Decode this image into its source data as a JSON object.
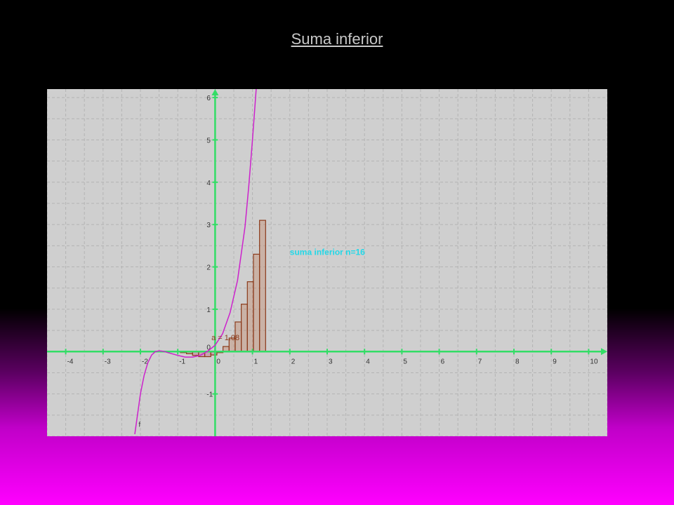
{
  "slide": {
    "title": "Suma inferior"
  },
  "chart_data": {
    "type": "bar",
    "title": "Suma inferior",
    "function_label": "f",
    "parameter_label": "a = 1.08",
    "sum_label": "suma inferior n=16",
    "xlim": [
      -4.5,
      10.5
    ],
    "ylim": [
      -2,
      6.2
    ],
    "x_ticks": [
      -4,
      -3,
      -2,
      -1,
      0,
      1,
      2,
      3,
      4,
      5,
      6,
      7,
      8,
      9,
      10
    ],
    "y_ticks": [
      -1,
      0,
      1,
      2,
      3,
      4,
      5,
      6
    ],
    "grid": true,
    "curve_points": [
      {
        "x": -2.15,
        "y": -1.95
      },
      {
        "x": -2.0,
        "y": -1.0
      },
      {
        "x": -1.9,
        "y": -0.56
      },
      {
        "x": -1.8,
        "y": -0.26
      },
      {
        "x": -1.7,
        "y": -0.08
      },
      {
        "x": -1.6,
        "y": 0.0
      },
      {
        "x": -1.5,
        "y": 0.02
      },
      {
        "x": -1.4,
        "y": 0.01
      },
      {
        "x": -1.2,
        "y": -0.04
      },
      {
        "x": -1.0,
        "y": -0.09
      },
      {
        "x": -0.8,
        "y": -0.13
      },
      {
        "x": -0.6,
        "y": -0.13
      },
      {
        "x": -0.4,
        "y": -0.09
      },
      {
        "x": -0.2,
        "y": 0.01
      },
      {
        "x": 0.0,
        "y": 0.15
      },
      {
        "x": 0.2,
        "y": 0.42
      },
      {
        "x": 0.4,
        "y": 0.92
      },
      {
        "x": 0.6,
        "y": 1.68
      },
      {
        "x": 0.8,
        "y": 2.95
      },
      {
        "x": 0.9,
        "y": 3.9
      },
      {
        "x": 1.0,
        "y": 5.0
      },
      {
        "x": 1.1,
        "y": 6.2
      },
      {
        "x": 1.2,
        "y": 7.0
      }
    ],
    "bar_width": 0.163,
    "bars": [
      {
        "x": -0.93,
        "value": -0.01
      },
      {
        "x": -0.767,
        "value": -0.05
      },
      {
        "x": -0.604,
        "value": -0.09
      },
      {
        "x": -0.441,
        "value": -0.12
      },
      {
        "x": -0.278,
        "value": -0.12
      },
      {
        "x": -0.115,
        "value": -0.08
      },
      {
        "x": 0.048,
        "value": 0.0
      },
      {
        "x": 0.211,
        "value": 0.12
      },
      {
        "x": 0.374,
        "value": 0.32
      },
      {
        "x": 0.537,
        "value": 0.7
      },
      {
        "x": 0.7,
        "value": 1.12
      },
      {
        "x": 0.863,
        "value": 1.65
      },
      {
        "x": 1.026,
        "value": 2.3
      },
      {
        "x": 1.189,
        "value": 3.1
      }
    ],
    "colors": {
      "background": "#cfcfcf",
      "grid": "#b4b4b4",
      "axes": "#33dd66",
      "curve": "#cc22cc",
      "bar_stroke": "#8b3a1a",
      "bar_fill": "#c07a58",
      "negative_fill": "#c04a7a",
      "sum_label": "#22d8e8",
      "parameter_label": "#8b3a1a"
    }
  }
}
